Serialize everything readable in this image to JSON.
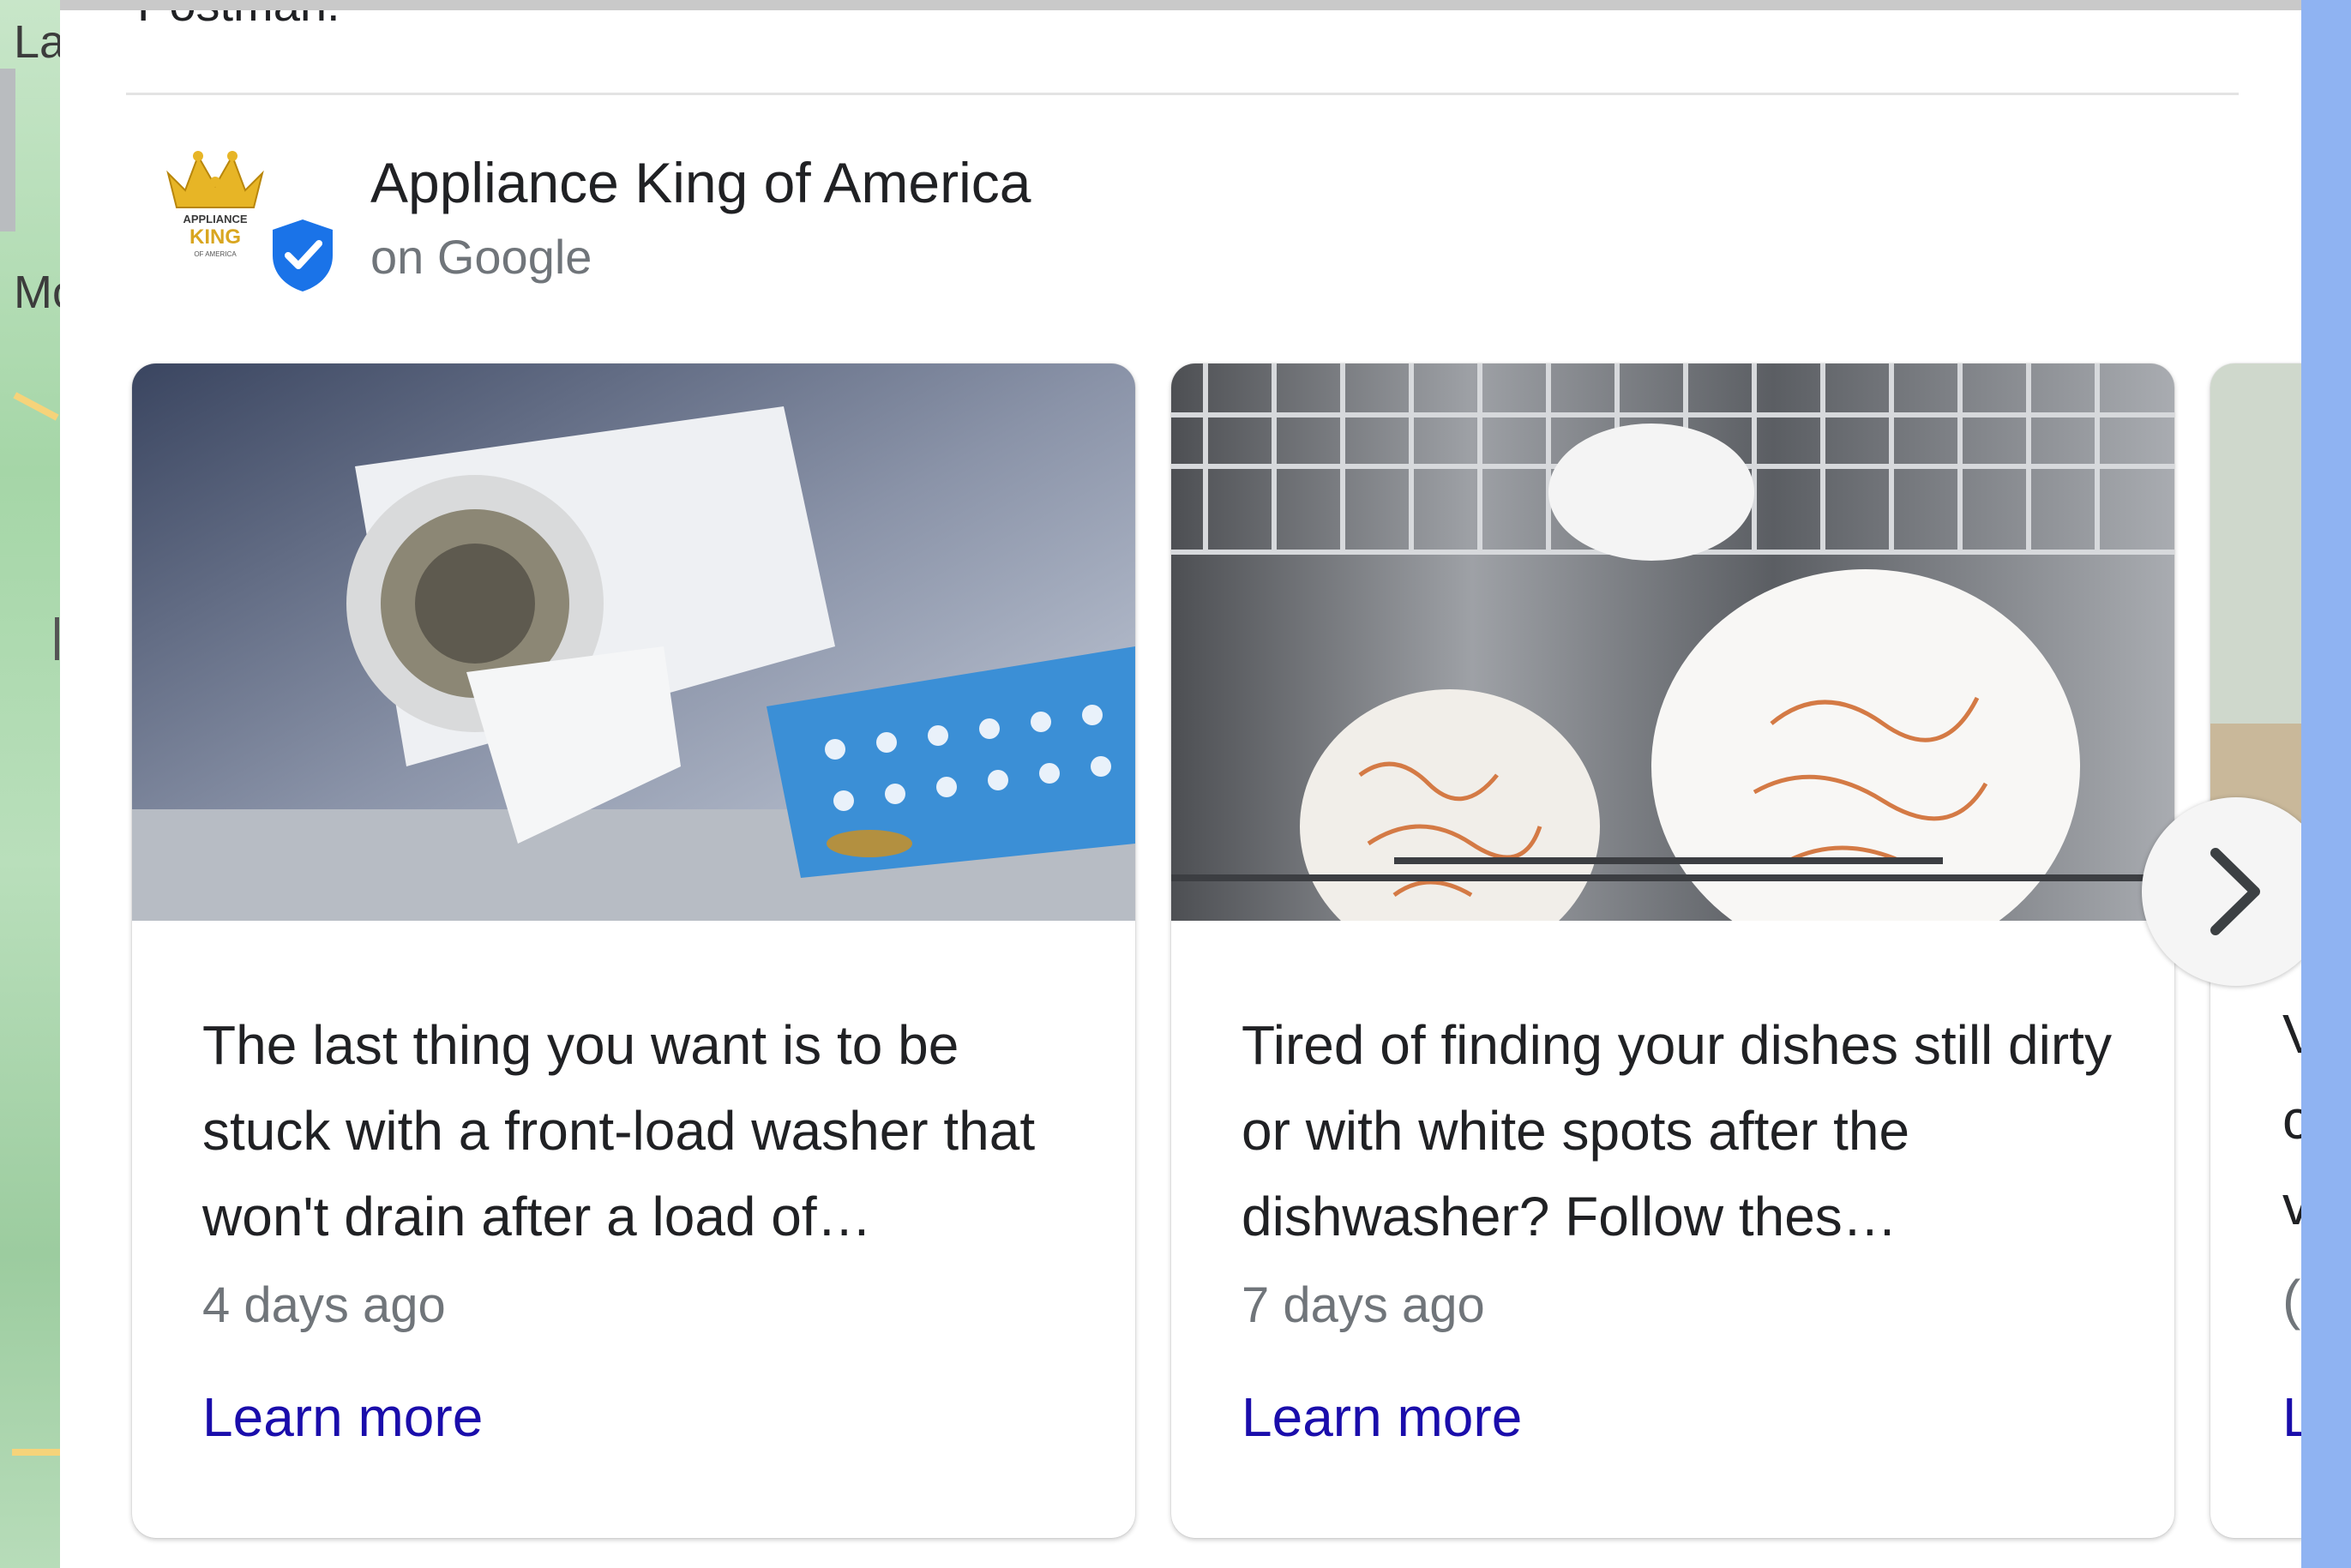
{
  "map": {
    "labels": [
      "La",
      "Mo"
    ]
  },
  "header": {
    "partial_text": "Postman.",
    "business_name": "Appliance King of America",
    "subtitle": "on Google",
    "logo_text": [
      "APPLIANCE",
      "KING",
      "OF AMERICA"
    ]
  },
  "posts": [
    {
      "text": "The last thing you want is to be stuck with a front-load washer that won't drain after a load of…",
      "date": "4 days ago",
      "link_label": "Learn more",
      "image_icon": "washer-drain-filter-photo"
    },
    {
      "text": "Tired of finding your dishes still dirty or with white spots after the dishwasher? Follow thes…",
      "date": "7 days ago",
      "link_label": "Learn more",
      "image_icon": "dishwasher-dirty-plates-photo"
    }
  ],
  "partial_card": {
    "fragments": [
      "V",
      "c",
      "v",
      "(",
      "L"
    ]
  },
  "colors": {
    "link": "#1a0dab",
    "verified_badge": "#1a73e8",
    "text_primary": "#202124",
    "text_secondary": "#70757a"
  }
}
